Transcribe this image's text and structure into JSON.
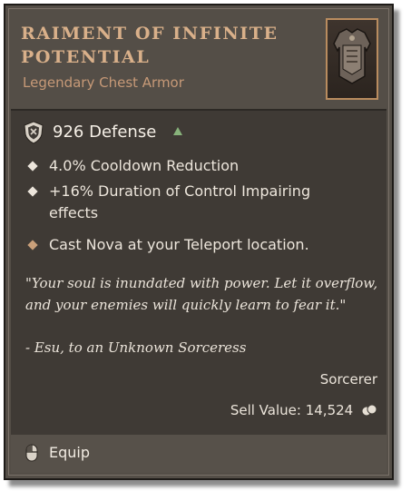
{
  "item": {
    "name_line1": "RAIMENT OF INFINITE",
    "name_line2": "POTENTIAL",
    "type": "Legendary Chest Armor",
    "portrait_icon": "chest-armor-icon"
  },
  "stats": {
    "defense": "926 Defense",
    "defense_trend_icon": "up-arrow-icon"
  },
  "affixes": [
    {
      "text": "4.0% Cooldown Reduction"
    },
    {
      "text": "+16% Duration of Control Impairing effects"
    }
  ],
  "legendary_power": "Cast Nova at your Teleport location.",
  "flavor": {
    "quote": "\"Your soul is inundated with power. Let it overflow, and your enemies will quickly learn to fear it.\"",
    "author": "- Esu, to an Unknown Sorceress"
  },
  "class_requirement": "Sorcerer",
  "sell_value": {
    "label": "Sell Value:",
    "amount": "14,524",
    "currency_icon": "gold-coin-icon"
  },
  "actions": {
    "equip_label": "Equip",
    "equip_icon": "mouse-button-icon"
  },
  "colors": {
    "title": "#d9b08a",
    "panel_dark": "#3f3a35",
    "panel_light": "#544e47",
    "upgrade_green": "#88b37b"
  }
}
